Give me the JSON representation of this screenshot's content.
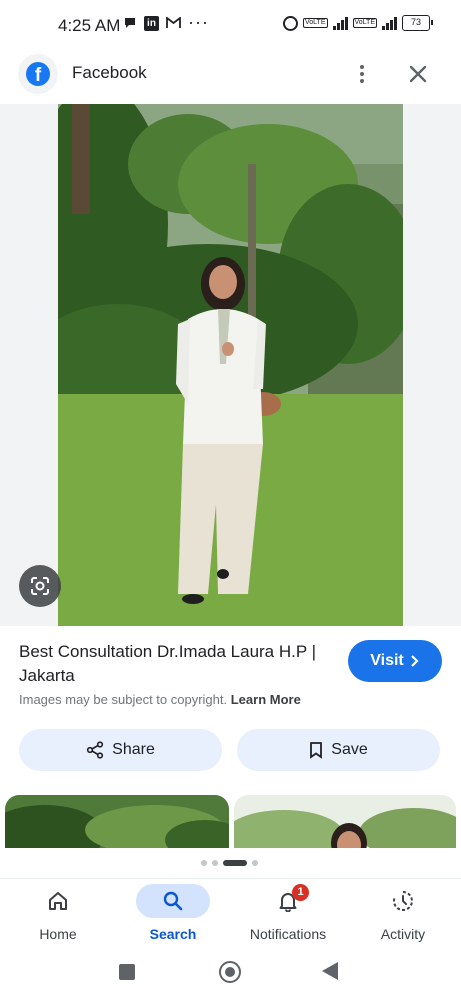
{
  "status_bar": {
    "time": "4:25 AM",
    "left_icons": [
      "chat-bubble-icon",
      "linkedin-icon",
      "gmail-icon"
    ],
    "more": "···",
    "linkedin_glyph": "in",
    "network": "4G",
    "battery": "73"
  },
  "header": {
    "app_title": "Facebook",
    "logo_glyph": "f"
  },
  "result": {
    "title": "Best Consultation Dr.Imada Laura H.P | Jakarta",
    "visit_label": "Visit",
    "copyright_text": "Images may be subject to copyright.",
    "learn_more": "Learn More"
  },
  "actions": {
    "share_label": "Share",
    "save_label": "Save"
  },
  "bottom_nav": {
    "items": [
      {
        "label": "Home",
        "icon": "home-icon"
      },
      {
        "label": "Search",
        "icon": "search-icon",
        "active": true
      },
      {
        "label": "Notifications",
        "icon": "bell-icon",
        "badge": "1"
      },
      {
        "label": "Activity",
        "icon": "activity-icon"
      }
    ]
  },
  "colors": {
    "accent": "#1a73e8",
    "facebook_blue": "#1877f2",
    "badge_red": "#d93025",
    "chip_bg": "#e8f0fe"
  }
}
